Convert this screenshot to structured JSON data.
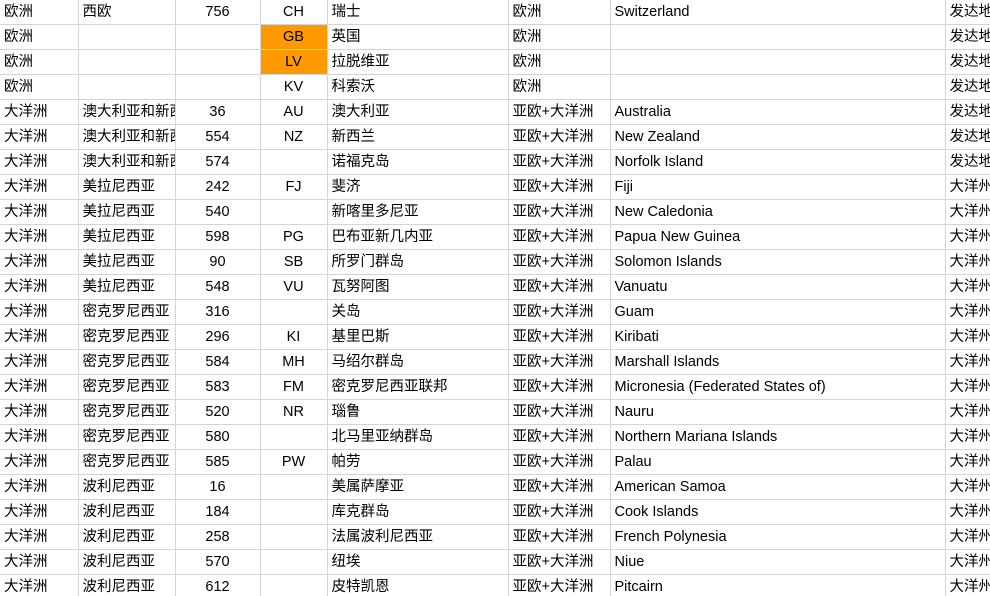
{
  "app": {
    "type": "spreadsheet",
    "accent_orange": "#ff9900",
    "selection_green": "#3c8c3c",
    "gridline": "#d4d4d4"
  },
  "columns": [
    {
      "key": "continent",
      "name": "continent-column"
    },
    {
      "key": "subregion",
      "name": "subregion-column"
    },
    {
      "key": "code_num",
      "name": "numeric-code-column"
    },
    {
      "key": "code_alpha",
      "name": "alpha-code-column"
    },
    {
      "key": "name_zh",
      "name": "chinese-name-column"
    },
    {
      "key": "region_zh",
      "name": "region-group-column"
    },
    {
      "key": "name_en",
      "name": "english-name-column"
    },
    {
      "key": "dev_status",
      "name": "development-status-column"
    }
  ],
  "rows": [
    {
      "continent": "欧洲",
      "subregion": "西欧",
      "code_num": "756",
      "code_alpha": "CH",
      "name_zh": "瑞士",
      "region_zh": "欧洲",
      "name_en": "Switzerland",
      "dev_status": "发达地区",
      "highlight": false
    },
    {
      "continent": "欧洲",
      "subregion": "",
      "code_num": "",
      "code_alpha": "GB",
      "name_zh": "英国",
      "region_zh": "欧洲",
      "name_en": "",
      "dev_status": "发达地区",
      "highlight": true
    },
    {
      "continent": "欧洲",
      "subregion": "",
      "code_num": "",
      "code_alpha": "LV",
      "name_zh": "拉脱维亚",
      "region_zh": "欧洲",
      "name_en": "",
      "dev_status": "发达地区",
      "highlight": true
    },
    {
      "continent": "欧洲",
      "subregion": "",
      "code_num": "",
      "code_alpha": "KV",
      "name_zh": "科索沃",
      "region_zh": "欧洲",
      "name_en": "",
      "dev_status": "发达地区",
      "highlight": false
    },
    {
      "continent": "大洋洲",
      "subregion": "澳大利亚和新西兰",
      "code_num": "36",
      "code_alpha": "AU",
      "name_zh": "澳大利亚",
      "region_zh": "亚欧+大洋洲",
      "name_en": "Australia",
      "dev_status": "发达地区",
      "highlight": false
    },
    {
      "continent": "大洋洲",
      "subregion": "澳大利亚和新西兰",
      "code_num": "554",
      "code_alpha": "NZ",
      "name_zh": "新西兰",
      "region_zh": "亚欧+大洋洲",
      "name_en": "New Zealand",
      "dev_status": "发达地区",
      "highlight": false
    },
    {
      "continent": "大洋洲",
      "subregion": "澳大利亚和新西兰",
      "code_num": "574",
      "code_alpha": "",
      "name_zh": "诺福克岛",
      "region_zh": "亚欧+大洋洲",
      "name_en": "Norfolk Island",
      "dev_status": "发达地区",
      "highlight": false
    },
    {
      "continent": "大洋洲",
      "subregion": "美拉尼西亚",
      "code_num": "242",
      "code_alpha": "FJ",
      "name_zh": "斐济",
      "region_zh": "亚欧+大洋洲",
      "name_en": "Fiji",
      "dev_status": "大洋州",
      "highlight": false
    },
    {
      "continent": "大洋洲",
      "subregion": "美拉尼西亚",
      "code_num": "540",
      "code_alpha": "",
      "name_zh": "新喀里多尼亚",
      "region_zh": "亚欧+大洋洲",
      "name_en": "New Caledonia",
      "dev_status": "大洋州",
      "highlight": false
    },
    {
      "continent": "大洋洲",
      "subregion": "美拉尼西亚",
      "code_num": "598",
      "code_alpha": "PG",
      "name_zh": "巴布亚新几内亚",
      "region_zh": "亚欧+大洋洲",
      "name_en": "Papua New Guinea",
      "dev_status": "大洋州",
      "highlight": false
    },
    {
      "continent": "大洋洲",
      "subregion": "美拉尼西亚",
      "code_num": "90",
      "code_alpha": "SB",
      "name_zh": "所罗门群岛",
      "region_zh": "亚欧+大洋洲",
      "name_en": "Solomon Islands",
      "dev_status": "大洋州",
      "highlight": false
    },
    {
      "continent": "大洋洲",
      "subregion": "美拉尼西亚",
      "code_num": "548",
      "code_alpha": "VU",
      "name_zh": "瓦努阿图",
      "region_zh": "亚欧+大洋洲",
      "name_en": "Vanuatu",
      "dev_status": "大洋州",
      "highlight": false
    },
    {
      "continent": "大洋洲",
      "subregion": "密克罗尼西亚",
      "code_num": "316",
      "code_alpha": "",
      "name_zh": "关岛",
      "region_zh": "亚欧+大洋洲",
      "name_en": "Guam",
      "dev_status": "大洋州",
      "highlight": false
    },
    {
      "continent": "大洋洲",
      "subregion": "密克罗尼西亚",
      "code_num": "296",
      "code_alpha": "KI",
      "name_zh": "基里巴斯",
      "region_zh": "亚欧+大洋洲",
      "name_en": "Kiribati",
      "dev_status": "大洋州",
      "highlight": false
    },
    {
      "continent": "大洋洲",
      "subregion": "密克罗尼西亚",
      "code_num": "584",
      "code_alpha": "MH",
      "name_zh": "马绍尔群岛",
      "region_zh": "亚欧+大洋洲",
      "name_en": "Marshall Islands",
      "dev_status": "大洋州",
      "highlight": false
    },
    {
      "continent": "大洋洲",
      "subregion": "密克罗尼西亚",
      "code_num": "583",
      "code_alpha": "FM",
      "name_zh": "密克罗尼西亚联邦",
      "region_zh": "亚欧+大洋洲",
      "name_en": "Micronesia (Federated States of)",
      "dev_status": "大洋州",
      "highlight": false
    },
    {
      "continent": "大洋洲",
      "subregion": "密克罗尼西亚",
      "code_num": "520",
      "code_alpha": "NR",
      "name_zh": "瑙鲁",
      "region_zh": "亚欧+大洋洲",
      "name_en": "Nauru",
      "dev_status": "大洋州",
      "highlight": false
    },
    {
      "continent": "大洋洲",
      "subregion": "密克罗尼西亚",
      "code_num": "580",
      "code_alpha": "",
      "name_zh": "北马里亚纳群岛",
      "region_zh": "亚欧+大洋洲",
      "name_en": "Northern Mariana Islands",
      "dev_status": "大洋州",
      "highlight": false
    },
    {
      "continent": "大洋洲",
      "subregion": "密克罗尼西亚",
      "code_num": "585",
      "code_alpha": "PW",
      "name_zh": "帕劳",
      "region_zh": "亚欧+大洋洲",
      "name_en": "Palau",
      "dev_status": "大洋州",
      "highlight": false
    },
    {
      "continent": "大洋洲",
      "subregion": "波利尼西亚",
      "code_num": "16",
      "code_alpha": "",
      "name_zh": "美属萨摩亚",
      "region_zh": "亚欧+大洋洲",
      "name_en": "American Samoa",
      "dev_status": "大洋州",
      "highlight": false
    },
    {
      "continent": "大洋洲",
      "subregion": "波利尼西亚",
      "code_num": "184",
      "code_alpha": "",
      "name_zh": "库克群岛",
      "region_zh": "亚欧+大洋洲",
      "name_en": "Cook Islands",
      "dev_status": "大洋州",
      "highlight": false
    },
    {
      "continent": "大洋洲",
      "subregion": "波利尼西亚",
      "code_num": "258",
      "code_alpha": "",
      "name_zh": "法属波利尼西亚",
      "region_zh": "亚欧+大洋洲",
      "name_en": "French Polynesia",
      "dev_status": "大洋州",
      "highlight": false
    },
    {
      "continent": "大洋洲",
      "subregion": "波利尼西亚",
      "code_num": "570",
      "code_alpha": "",
      "name_zh": "纽埃",
      "region_zh": "亚欧+大洋洲",
      "name_en": "Niue",
      "dev_status": "大洋州",
      "highlight": false
    },
    {
      "continent": "大洋洲",
      "subregion": "波利尼西亚",
      "code_num": "612",
      "code_alpha": "",
      "name_zh": "皮特凯恩",
      "region_zh": "亚欧+大洋洲",
      "name_en": "Pitcairn",
      "dev_status": "大洋州",
      "highlight": false
    }
  ]
}
